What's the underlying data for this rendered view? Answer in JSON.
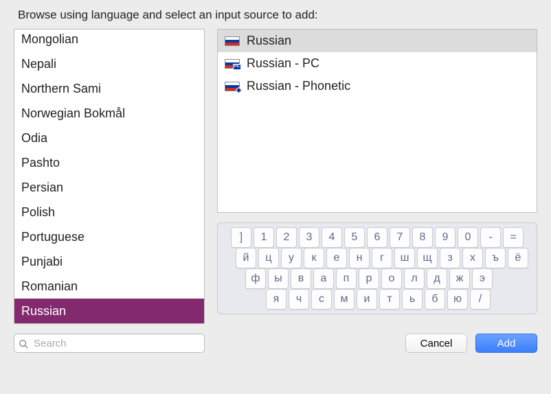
{
  "instruction": "Browse using language and select an input source to add:",
  "languages": [
    {
      "label": "Mongolian",
      "cut": true
    },
    {
      "label": "Nepali"
    },
    {
      "label": "Northern Sami"
    },
    {
      "label": "Norwegian Bokmål"
    },
    {
      "label": "Odia"
    },
    {
      "label": "Pashto"
    },
    {
      "label": "Persian"
    },
    {
      "label": "Polish"
    },
    {
      "label": "Portuguese"
    },
    {
      "label": "Punjabi"
    },
    {
      "label": "Romanian"
    },
    {
      "label": "Russian",
      "selected": true
    }
  ],
  "sources": [
    {
      "label": "Russian",
      "selected": true,
      "badge": "none"
    },
    {
      "label": "Russian - PC",
      "badge": "pc"
    },
    {
      "label": "Russian - Phonetic",
      "badge": "dot"
    }
  ],
  "keyboard": {
    "rows": [
      [
        "]",
        "1",
        "2",
        "3",
        "4",
        "5",
        "6",
        "7",
        "8",
        "9",
        "0",
        "-",
        "="
      ],
      [
        "й",
        "ц",
        "у",
        "к",
        "е",
        "н",
        "г",
        "ш",
        "щ",
        "з",
        "х",
        "ъ",
        "ё"
      ],
      [
        "ф",
        "ы",
        "в",
        "а",
        "п",
        "р",
        "о",
        "л",
        "д",
        "ж",
        "э"
      ],
      [
        "я",
        "ч",
        "с",
        "м",
        "и",
        "т",
        "ь",
        "б",
        "ю",
        "/"
      ]
    ]
  },
  "search": {
    "placeholder": "Search"
  },
  "buttons": {
    "cancel": "Cancel",
    "add": "Add"
  }
}
